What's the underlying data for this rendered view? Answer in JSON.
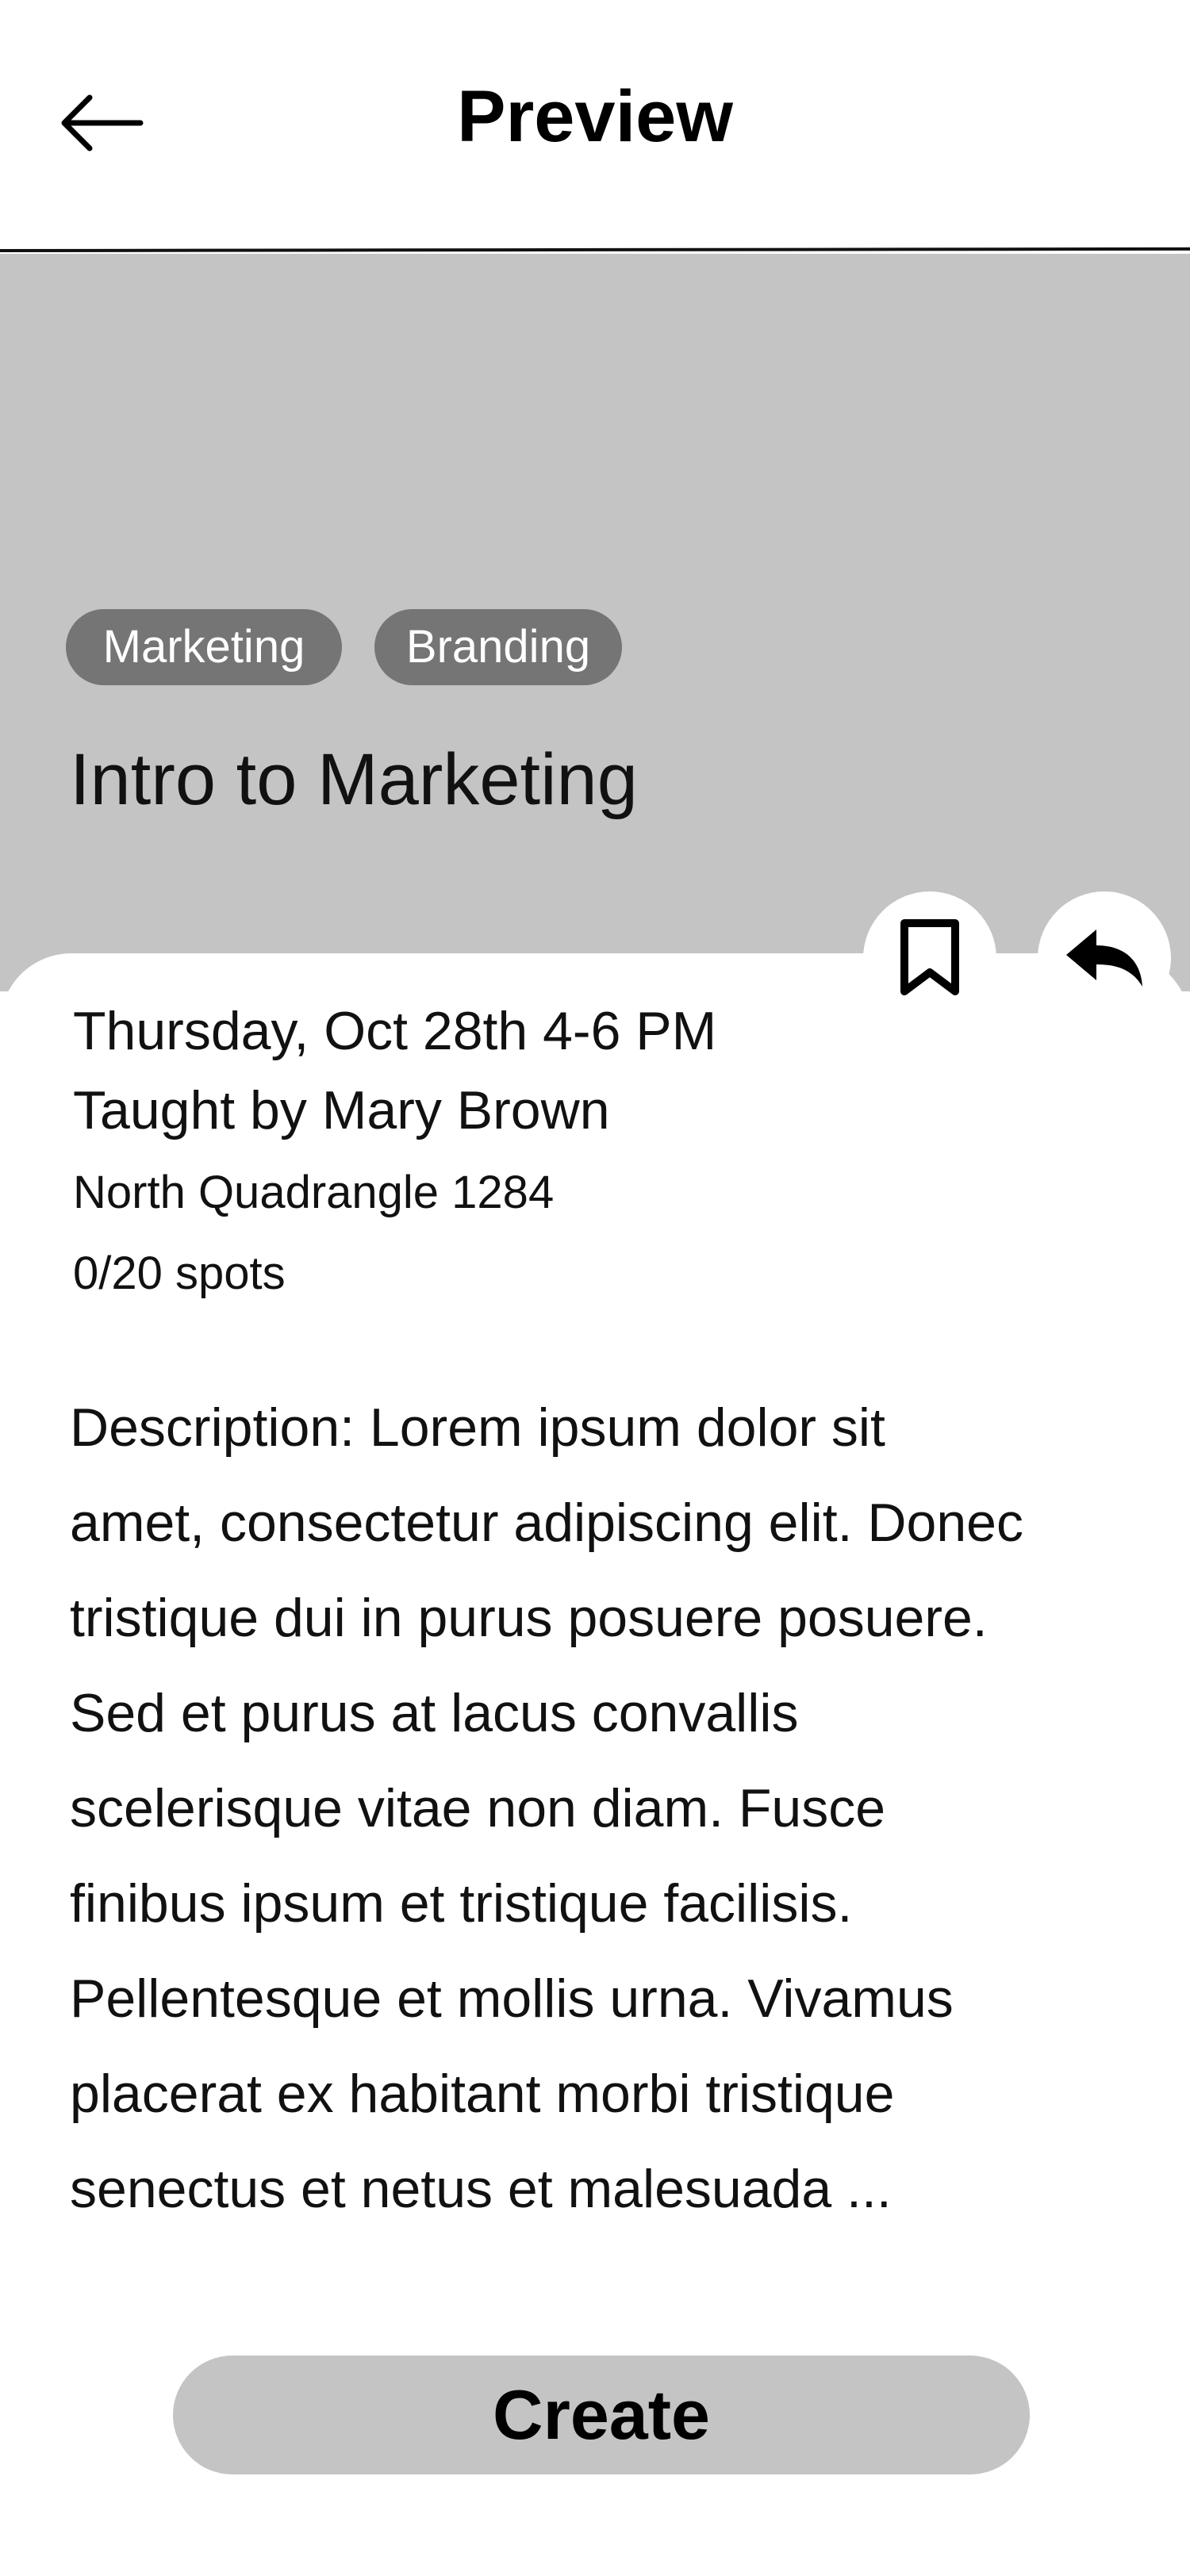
{
  "header": {
    "title": "Preview",
    "back_icon": "arrow-left-icon"
  },
  "hero": {
    "background_color": "#c4c4c4",
    "tags": [
      "Marketing",
      "Branding"
    ],
    "course_title": "Intro to Marketing"
  },
  "actions": {
    "bookmark_icon": "bookmark-icon",
    "share_icon": "reply-arrow-icon"
  },
  "details": {
    "date_time": "Thursday, Oct 28th 4-6 PM",
    "teacher": "Taught by Mary Brown",
    "location": "North Quadrangle 1284",
    "spots": "0/20 spots"
  },
  "description": {
    "lines": [
      "Description: Lorem ipsum dolor sit",
      "amet, consectetur adipiscing elit. Donec",
      "tristique dui in purus posuere posuere.",
      "Sed et purus at lacus convallis",
      "scelerisque vitae non diam. Fusce",
      "finibus ipsum et tristique facilisis.",
      "Pellentesque et mollis urna. Vivamus",
      "placerat ex habitant morbi tristique",
      "senectus et netus et malesuada ..."
    ]
  },
  "footer": {
    "create_label": "Create",
    "button_color": "#c4c4c4"
  }
}
